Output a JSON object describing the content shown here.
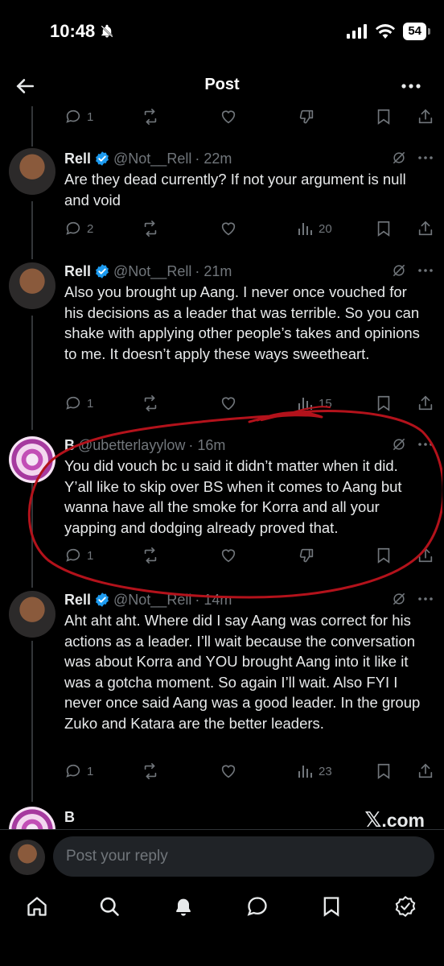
{
  "status": {
    "time": "10:48",
    "battery": "54"
  },
  "header": {
    "title": "Post"
  },
  "top_actions": {
    "replies": "1"
  },
  "tweets": [
    {
      "name": "Rell",
      "handle": "@Not__Rell",
      "time": "· 22m",
      "text": "Are they dead currently? If not your argument is null and void",
      "replies": "2",
      "views": "20"
    },
    {
      "name": "Rell",
      "handle": "@Not__Rell",
      "time": "· 21m",
      "text": "Also you brought up Aang. I never once vouched for his decisions as a leader that was terrible. So you can shake with applying other people’s takes and opinions to me. It doesn’t apply these ways sweetheart.",
      "replies": "1",
      "views": "15"
    },
    {
      "name": "B",
      "handle": "@ubetterlayylow",
      "time": "· 16m",
      "text": "You did vouch bc u said it didn’t matter when it did. Y’all like to skip over BS when it comes to Aang but wanna have all the smoke for Korra and all your yapping and dodging already proved that.",
      "replies": "1"
    },
    {
      "name": "Rell",
      "handle": "@Not__Rell",
      "time": "· 14m",
      "text": "Aht aht aht. Where did I say Aang was correct for his actions as a leader. I’ll wait because the conversation was about Korra and YOU brought Aang into it like it was a gotcha moment. So again I’ll wait. Also FYI I never once said Aang was a good leader. In the group Zuko and Katara are the better leaders.",
      "replies": "1",
      "views": "23"
    },
    {
      "name": "B"
    }
  ],
  "watermark": {
    "x": "𝕏",
    "domain": ".com"
  },
  "reply": {
    "placeholder": "Post your reply"
  },
  "annotation": {
    "color": "#b3121b"
  },
  "colors": {
    "background": "#000000",
    "text": "#e7e9ea",
    "muted": "#71767b",
    "verified": "#1d9bf0"
  },
  "icons": [
    "back-arrow-icon",
    "more-icon",
    "reply-icon",
    "repost-icon",
    "like-icon",
    "downvote-icon",
    "views-icon",
    "bookmark-icon",
    "share-icon",
    "grok-icon",
    "home-icon",
    "search-icon",
    "notifications-icon",
    "messages-icon",
    "bookmarks-icon",
    "verified-icon"
  ]
}
